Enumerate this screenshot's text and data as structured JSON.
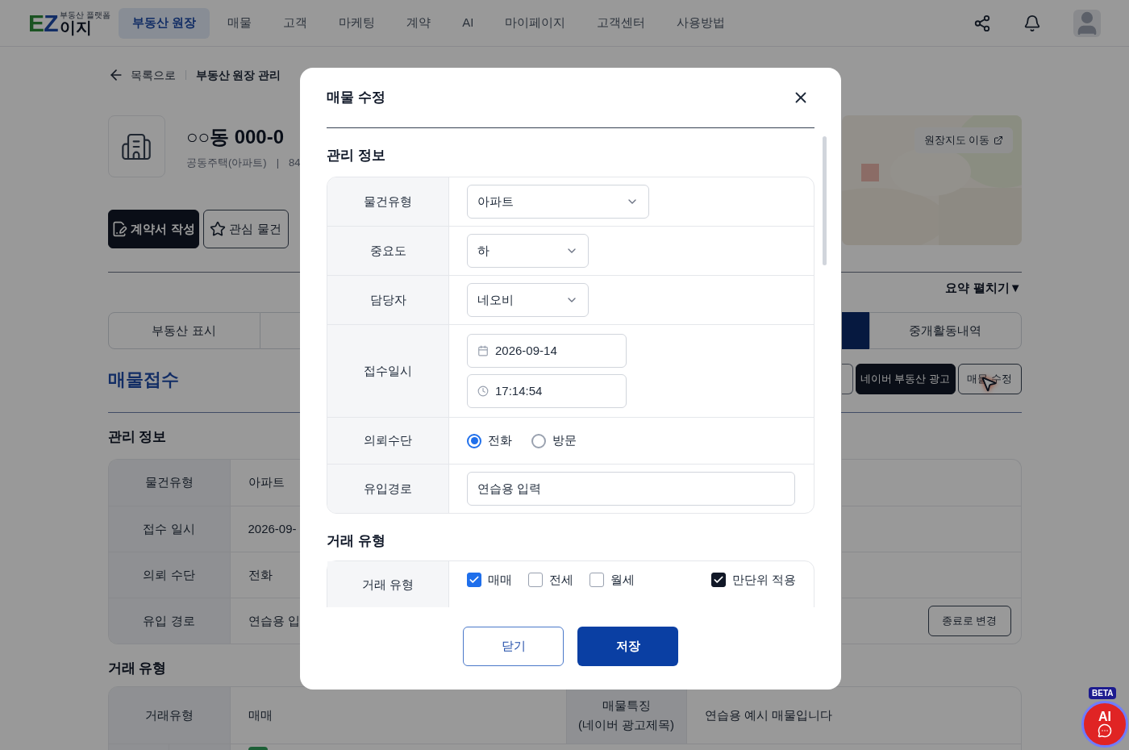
{
  "nav": {
    "logo_mark_e": "E",
    "logo_mark_z": "Z",
    "logo_text": "이지",
    "logo_tagline": "부동산 플랫폼",
    "items": [
      {
        "label": "부동산 원장",
        "selected": true
      },
      {
        "label": "매물",
        "selected": false
      },
      {
        "label": "고객",
        "selected": false
      },
      {
        "label": "마케팅",
        "selected": false
      },
      {
        "label": "계약",
        "selected": false
      },
      {
        "label": "AI",
        "selected": false
      },
      {
        "label": "마이페이지",
        "selected": false
      },
      {
        "label": "고객센터",
        "selected": false
      },
      {
        "label": "사용방법",
        "selected": false
      }
    ]
  },
  "breadcrumb": {
    "back": "목록으로",
    "current": "부동산 원장 관리"
  },
  "property": {
    "title": "○○동 000-0",
    "type": "공동주택(아파트)",
    "separator": "|",
    "area": "84"
  },
  "actions": [
    {
      "label": "계약서 작성",
      "kind": "primary"
    },
    {
      "label": "관심 물건",
      "kind": "outline"
    }
  ],
  "map_button": "원장지도 이동",
  "summary_toggle": "요약 펼치기▼",
  "tabs": [
    {
      "label": "부동산 표시",
      "selected": false
    },
    {
      "selected": true
    },
    {
      "label": "중개활동내역",
      "selected": false
    }
  ],
  "section_title": "매물접수",
  "record_buttons": [
    {
      "label": "네이버 부동산 광고",
      "kind": "primary"
    },
    {
      "label": "매물 수정",
      "kind": "outline"
    }
  ],
  "management": {
    "title": "관리 정보",
    "rows": [
      {
        "label": "물건유형",
        "value": "아파트"
      },
      {
        "label": "접수 일시",
        "value": "2026-09-"
      },
      {
        "label": "의뢰 수단",
        "value": "전화"
      },
      {
        "label": "유입 경로",
        "value": "연습용 입"
      }
    ],
    "end_button": "종료로 변경"
  },
  "deal": {
    "title": "거래 유형",
    "label": "거래유형",
    "value": "매매",
    "feature_label": [
      "매물특징",
      "(네이버 광고제목)"
    ],
    "feature_value": "연습용 예시 매물입니다"
  },
  "modal": {
    "title": "매물 수정",
    "management_title": "관리 정보",
    "fields": [
      {
        "label": "물건유형",
        "kind": "select",
        "value": "아파트"
      },
      {
        "label": "중요도",
        "kind": "select",
        "value": "하"
      },
      {
        "label": "담당자",
        "kind": "select",
        "value": "네오비"
      },
      {
        "label": "접수일시",
        "kind": "datetime",
        "date": "2026-09-14",
        "time": "17:14:54"
      },
      {
        "label": "의뢰수단",
        "kind": "radio",
        "options": [
          {
            "label": "전화",
            "selected": true
          },
          {
            "label": "방문",
            "selected": false
          }
        ]
      },
      {
        "label": "유입경로",
        "kind": "text",
        "value": "연습용 입력"
      }
    ],
    "deal_title": "거래 유형",
    "deal_label": "거래 유형",
    "deal_options": [
      {
        "label": "매매",
        "checked": true
      },
      {
        "label": "전세",
        "checked": false
      },
      {
        "label": "월세",
        "checked": false
      }
    ],
    "unit_option": {
      "label": "만단위 적용",
      "checked": true
    },
    "buttons": [
      {
        "label": "닫기",
        "kind": "secondary"
      },
      {
        "label": "저장",
        "kind": "primary"
      }
    ]
  },
  "ai_button": {
    "badge": "BETA",
    "label": "AI"
  }
}
